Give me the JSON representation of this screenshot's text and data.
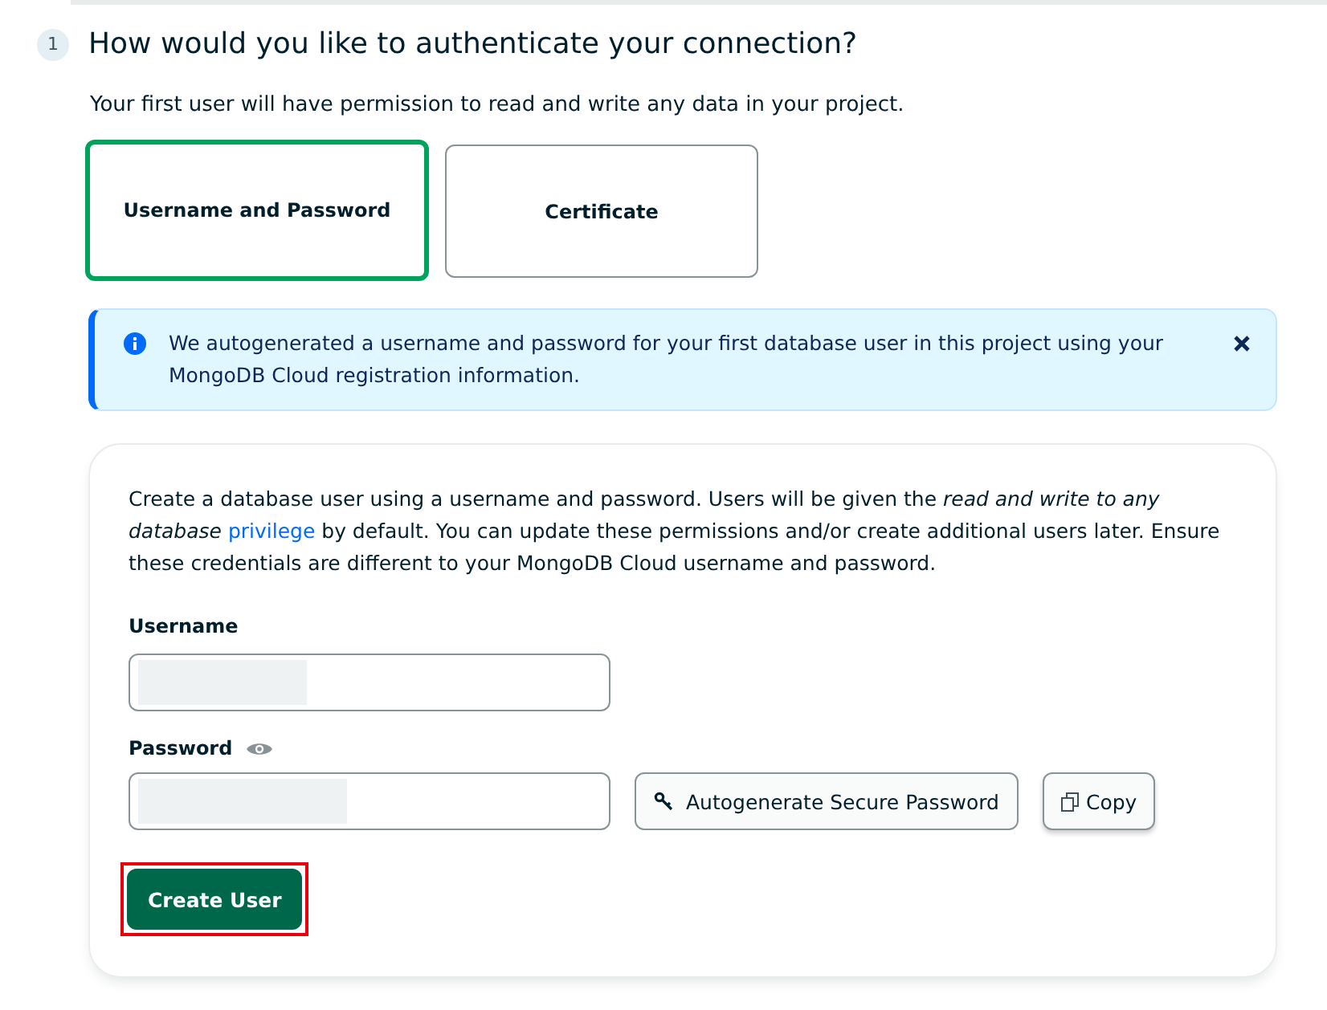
{
  "step": {
    "number": "1",
    "title": "How would you like to authenticate your connection?"
  },
  "subtitle": "Your first user will have permission to read and write any data in your project.",
  "auth_options": [
    {
      "label": "Username and Password",
      "selected": true
    },
    {
      "label": "Certificate",
      "selected": false
    }
  ],
  "alert": {
    "text": "We autogenerated a username and password for your first database user in this project using your MongoDB Cloud registration information."
  },
  "form": {
    "description_before": "Create a database user using a username and password. Users will be given the *read and write to any database* ",
    "description_link": "privilege",
    "description_after": " by default. You can update these permissions and/or create additional users later. Ensure these credentials are different to your MongoDB Cloud username and password.",
    "username_label": "Username",
    "password_label": "Password",
    "autogenerate_button": "Autogenerate Secure Password",
    "copy_button": "Copy",
    "create_button": "Create User",
    "create_highlighted": true
  }
}
